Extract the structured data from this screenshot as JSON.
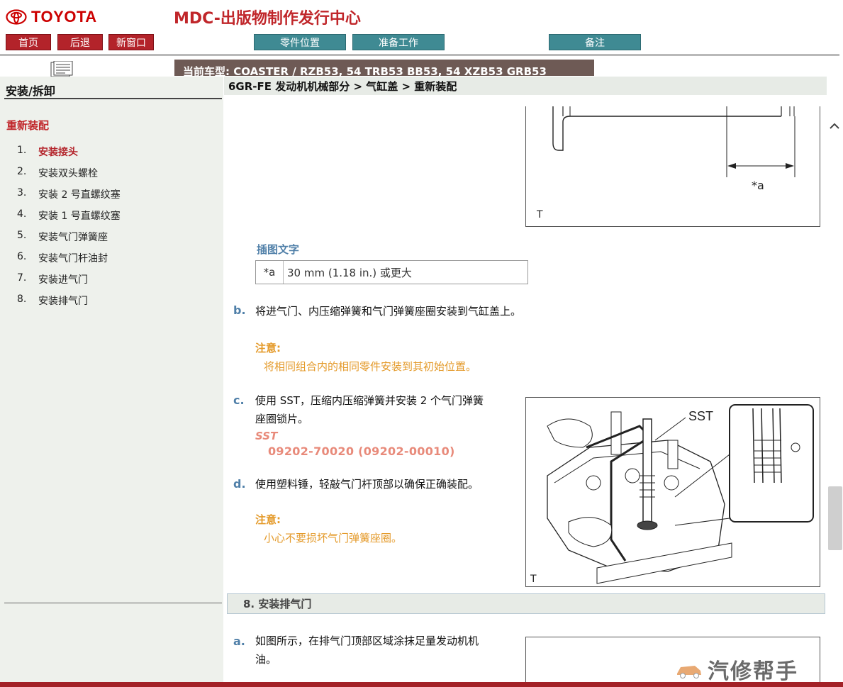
{
  "header": {
    "brand": "TOYOTA",
    "title": "MDC-出版物制作发行中心",
    "nav_buttons": [
      "首页",
      "后退",
      "新窗口"
    ],
    "tab_buttons": [
      "零件位置",
      "准备工作",
      "备注"
    ],
    "current_model": "当前车型:  COASTER / RZB53, 54 TRB53 BB53, 54 XZB53 GRB53"
  },
  "sidebar": {
    "title": "安装/拆卸",
    "section": "重新装配",
    "items": [
      {
        "num": "1.",
        "label": "安装接头"
      },
      {
        "num": "2.",
        "label": "安装双头螺栓"
      },
      {
        "num": "3.",
        "label": "安装 2 号直螺纹塞"
      },
      {
        "num": "4.",
        "label": "安装 1 号直螺纹塞"
      },
      {
        "num": "5.",
        "label": "安装气门弹簧座"
      },
      {
        "num": "6.",
        "label": "安装气门杆油封"
      },
      {
        "num": "7.",
        "label": "安装进气门"
      },
      {
        "num": "8.",
        "label": "安装排气门"
      }
    ],
    "active_index": 0
  },
  "breadcrumb": "6GR-FE 发动机机械部分 > 气缸盖 > 重新装配",
  "figure_top": {
    "callout": "*a",
    "corner_label": "T"
  },
  "caption": {
    "label": "插图文字",
    "key": "*a",
    "value": "30 mm (1.18 in.) 或更大"
  },
  "steps": {
    "b": {
      "letter": "b.",
      "text": "将进气门、内压缩弹簧和气门弹簧座圈安装到气缸盖上。"
    },
    "b_note": {
      "title": "注意:",
      "text": "将相同组合内的相同零件安装到其初始位置。"
    },
    "c": {
      "letter": "c.",
      "line1": "使用 SST，压缩内压缩弹簧并安装 2 个气门弹簧",
      "line2": "座圈锁片。"
    },
    "sst": {
      "label": "SST",
      "number": "09202-70020  (09202-00010)"
    },
    "d": {
      "letter": "d.",
      "text": "使用塑料锤，轻敲气门杆顶部以确保正确装配。"
    },
    "d_note": {
      "title": "注意:",
      "text": "小心不要损坏气门弹簧座圈。"
    }
  },
  "figure_mid": {
    "callout": "SST",
    "corner_label": "T"
  },
  "section8": {
    "title": "8. 安装排气门",
    "a": {
      "letter": "a.",
      "line1": "如图所示，在排气门顶部区域涂抹足量发动机机",
      "line2": "油。"
    }
  },
  "watermark": "汽修帮手",
  "colors": {
    "brand_red": "#b3232a",
    "tab_teal": "#3f8a93",
    "step_blue": "#4f7fa8",
    "note_orange": "#e49a2a",
    "sst_pink": "#e88a7a"
  }
}
